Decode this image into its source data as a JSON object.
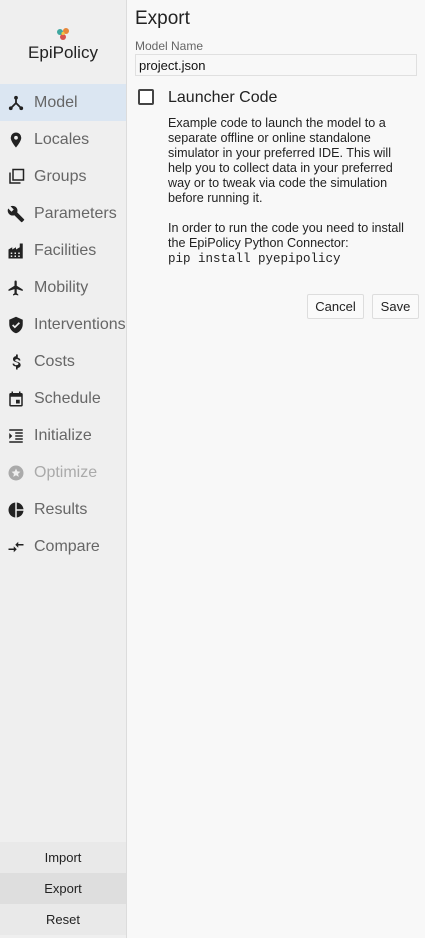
{
  "app": {
    "logo_text": "EpiPolicy"
  },
  "sidebar": {
    "items": [
      {
        "label": "Model",
        "icon": "model-icon"
      },
      {
        "label": "Locales",
        "icon": "location-pin-icon"
      },
      {
        "label": "Groups",
        "icon": "layers-icon"
      },
      {
        "label": "Parameters",
        "icon": "wrench-icon"
      },
      {
        "label": "Facilities",
        "icon": "building-icon"
      },
      {
        "label": "Mobility",
        "icon": "airplane-icon"
      },
      {
        "label": "Interventions",
        "icon": "shield-icon"
      },
      {
        "label": "Costs",
        "icon": "dollar-icon"
      },
      {
        "label": "Schedule",
        "icon": "calendar-icon"
      },
      {
        "label": "Initialize",
        "icon": "indent-icon"
      },
      {
        "label": "Optimize",
        "icon": "star-circle-icon"
      },
      {
        "label": "Results",
        "icon": "pie-chart-icon"
      },
      {
        "label": "Compare",
        "icon": "compare-arrows-icon"
      }
    ],
    "active": "Model",
    "disabled": "Optimize",
    "bottom": {
      "import": "Import",
      "export": "Export",
      "reset": "Reset"
    }
  },
  "export_panel": {
    "title": "Export",
    "model_name_label": "Model Name",
    "model_name_value": "project.json",
    "launcher_code_label": "Launcher Code",
    "launcher_code_checked": false,
    "description": "Example code to launch the model to a separate offline or online standalone simulator in your preferred IDE. This will help you to collect data in your preferred way or to tweak via code the simulation before running it.",
    "install_note": "In order to run the code you need to install the EpiPolicy Python Connector:",
    "install_command": "pip install pyepipolicy",
    "cancel_label": "Cancel",
    "save_label": "Save"
  },
  "colors": {
    "active_nav_bg": "#dbe6f2",
    "sidebar_bg": "#efefef",
    "main_bg": "#f8f8f8"
  }
}
